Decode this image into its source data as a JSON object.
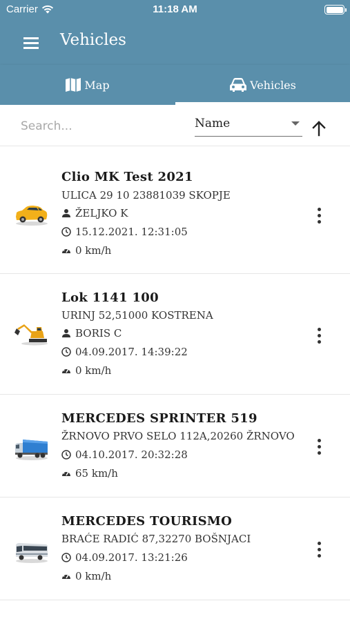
{
  "status_bar": {
    "carrier": "Carrier",
    "time": "11:18 AM"
  },
  "app_bar": {
    "title": "Vehicles"
  },
  "tabs": [
    {
      "label": "Map",
      "icon": "map-icon",
      "active": false
    },
    {
      "label": "Vehicles",
      "icon": "car-icon",
      "active": true
    }
  ],
  "filter": {
    "search_placeholder": "Search...",
    "sort_value": "Name"
  },
  "colors": {
    "primary": "#5a8fab",
    "text": "#222222",
    "divider": "#e6e6e6"
  },
  "vehicles": [
    {
      "name": "Clio MK Test 2021",
      "address": "ULICA 29 10 23881039 SKOPJE",
      "driver": "ŽELJKO K",
      "datetime": "15.12.2021. 12:31:05",
      "speed": "0 km/h",
      "icon": "yellow-car-icon"
    },
    {
      "name": "Lok 1141 100",
      "address": "URINJ 52,51000 KOSTRENA",
      "driver": "BORIS C",
      "datetime": "04.09.2017. 14:39:22",
      "speed": "0 km/h",
      "icon": "excavator-icon"
    },
    {
      "name": "MERCEDES SPRINTER 519",
      "address": "ŽRNOVO PRVO SELO 112A,20260 ŽRNOVO",
      "datetime": "04.10.2017. 20:32:28",
      "speed": "65 km/h",
      "icon": "truck-icon"
    },
    {
      "name": "MERCEDES TOURISMO",
      "address": "BRAĆE RADIĆ 87,32270 BOŠNJACI",
      "datetime": "04.09.2017. 13:21:26",
      "speed": "0 km/h",
      "icon": "bus-icon"
    }
  ]
}
